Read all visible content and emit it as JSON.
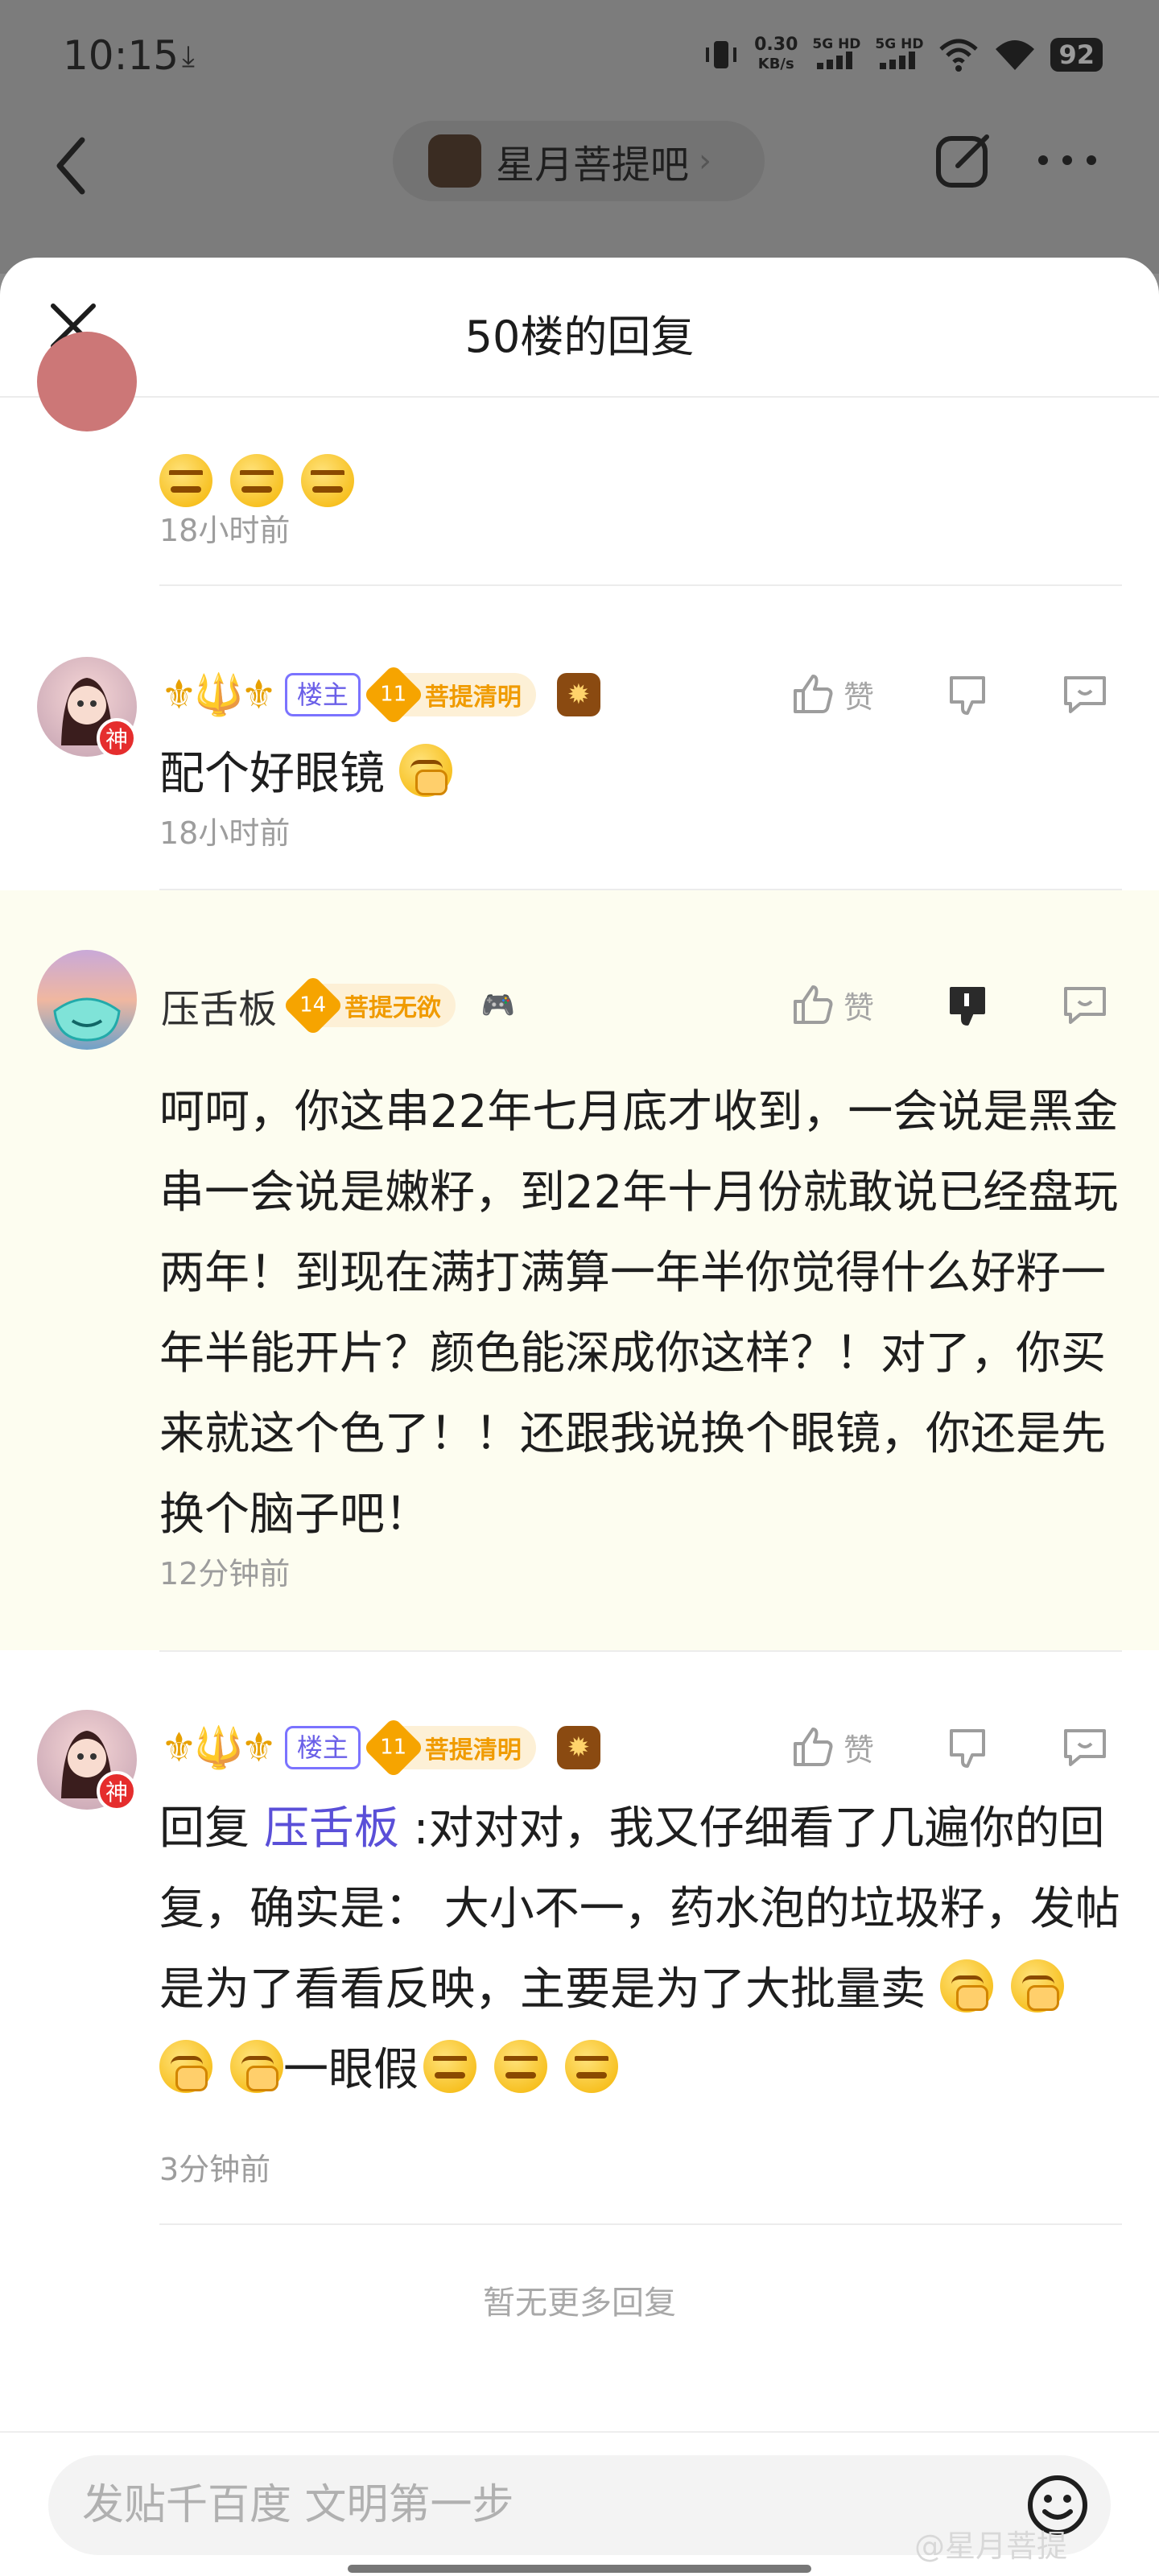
{
  "status_bar": {
    "time": "10:15",
    "download_icon": "download-arrow-icon",
    "net_speed_value": "0.30",
    "net_speed_unit": "KB/s",
    "signal1_label": "5G HD",
    "signal2_label": "5G HD",
    "battery": "92"
  },
  "top_nav": {
    "forum_name": "星月菩提吧",
    "forum_chevron": "›"
  },
  "sheet": {
    "title": "50楼的回复"
  },
  "replies": [
    {
      "id": "partial",
      "timestamp": "18小时前"
    },
    {
      "id": "r1",
      "user_badges": "⚜🔱⚜",
      "owner_tag": "楼主",
      "level_num": "11",
      "level_name": "菩提清明",
      "like_label": "赞",
      "content": "配个好眼镜",
      "timestamp": "18小时前"
    },
    {
      "id": "r2",
      "username": "压舌板",
      "level_num": "14",
      "level_name": "菩提无欲",
      "like_label": "赞",
      "content": "呵呵，你这串22年七月底才收到，一会说是黑金串一会说是嫩籽，到22年十月份就敢说已经盘玩两年！到现在满打满算一年半你觉得什么好籽一年半能开片？颜色能深成你这样？！对了，你买来就这个色了！！还跟我说换个眼镜，你还是先换个脑子吧！",
      "timestamp": "12分钟前"
    },
    {
      "id": "r3",
      "user_badges": "⚜🔱⚜",
      "owner_tag": "楼主",
      "level_num": "11",
      "level_name": "菩提清明",
      "like_label": "赞",
      "reply_prefix": "回复",
      "mention": "压舌板",
      "content_line1": " :对对对，我又仔细看了几遍你的回复，确实是： 大小不一，药水泡的垃圾籽，发帖是为了看看反映，主要是为了大批量卖",
      "content_tail": "一眼假",
      "timestamp": "3分钟前"
    }
  ],
  "avatar_badge": "神",
  "no_more": "暂无更多回复",
  "input": {
    "placeholder": "发贴千百度 文明第一步"
  },
  "watermark": "@星月菩提"
}
